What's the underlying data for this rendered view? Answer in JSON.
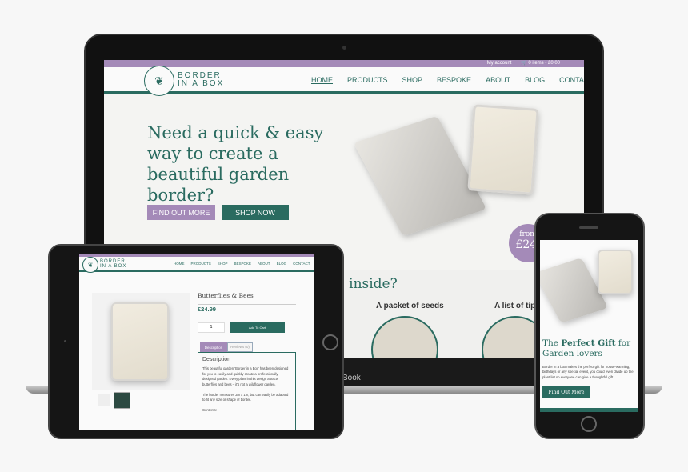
{
  "colors": {
    "brand": "#2a6b60",
    "accent": "#a48ab8",
    "background": "#f4f4f2"
  },
  "laptop": {
    "brand_label": "Book",
    "topbar": {
      "account": "My account",
      "cart": "0 items - £0.00",
      "cart_icon": "cart-icon"
    },
    "logo": {
      "line1": "BORDER",
      "line2": "IN A BOX",
      "icon": "butterfly-icon"
    },
    "nav": [
      "HOME",
      "PRODUCTS",
      "SHOP",
      "BESPOKE",
      "ABOUT",
      "BLOG",
      "CONTACT"
    ],
    "hero": {
      "headline": "Need a quick & easy way to create a beautiful garden border?",
      "find_out_more": "FIND OUT MORE",
      "shop_now": "SHOP NOW",
      "badge_from": "from",
      "badge_price": "£24."
    },
    "section": {
      "title": "s inside?",
      "features": [
        "A packet of seeds",
        "A list of tips"
      ]
    }
  },
  "tablet": {
    "logo": {
      "line1": "BORDER",
      "line2": "IN A BOX"
    },
    "nav": [
      "HOME",
      "PRODUCTS",
      "SHOP",
      "BESPOKE",
      "ABOUT",
      "BLOG",
      "CONTACT"
    ],
    "product": {
      "title": "Butterflies & Bees",
      "price": "£24.99",
      "quantity": "1",
      "add_to_cart": "Add To Cart",
      "tabs": [
        "Description",
        "Reviews (0)"
      ],
      "desc_heading": "Description",
      "desc_p1": "This beautiful garden 'Border in a Box' has been designed for you to easily and quickly create a professionally designed garden.  Every plant in this design attracts butterflies and bees – it's not a wildflower garden.",
      "desc_p2": "The border measures 2m x 1m, but can easily be adapted to fit any size or shape of border.",
      "desc_p3": "Contents:"
    }
  },
  "phone": {
    "headline_pre": "The ",
    "headline_bold": "Perfect Gift",
    "headline_post": " for Garden lovers",
    "body": "Border in a box makes the perfect gift for house-warming, birthdays or any special event, you could even divide up the plant list so everyone can give a thoughtful gift.",
    "button": "Find Out More"
  }
}
